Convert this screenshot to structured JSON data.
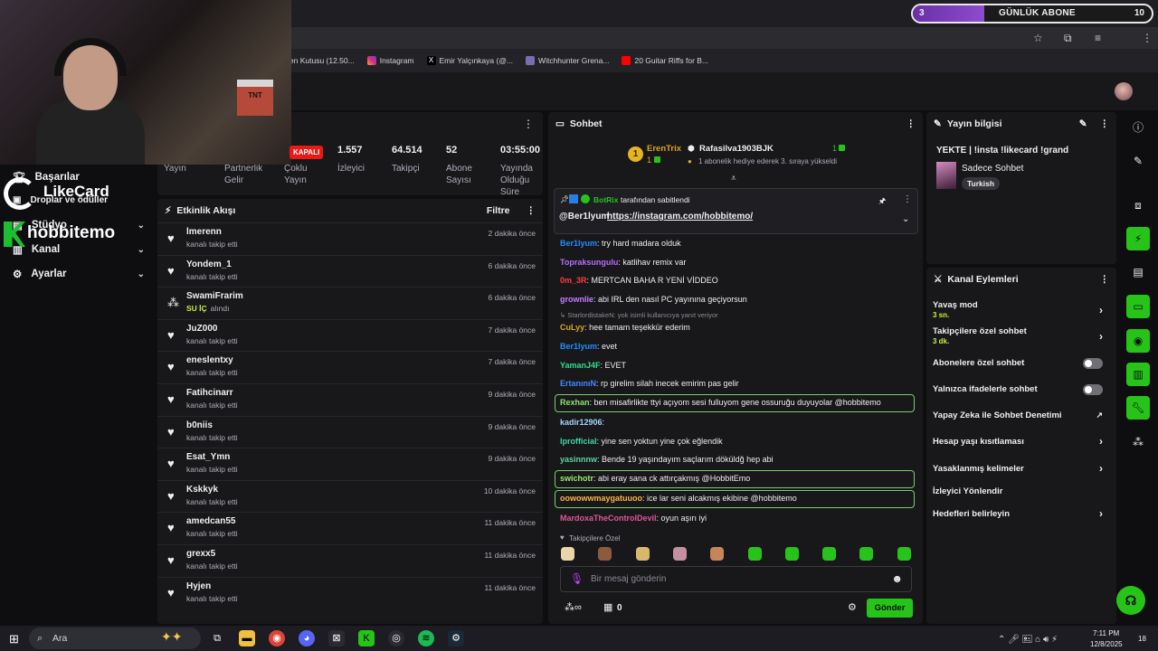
{
  "sub_goal": {
    "current": "3",
    "label": "GÜNLÜK ABONE",
    "target": "10",
    "progress": 0.3
  },
  "bookmarks": [
    {
      "label": "len Kutusu (12.50..."
    },
    {
      "label": "Instagram"
    },
    {
      "label": "Emir Yalçınkaya (@..."
    },
    {
      "label": "Witchhunter Grena..."
    },
    {
      "label": "20 Guitar Riffs for B..."
    }
  ],
  "overlays": {
    "likecard": "LikeCard",
    "hobbitemo": "hobbitemo",
    "tnt": "TNT"
  },
  "nav": {
    "achievements": "Başarılar",
    "drops": "Droplar ve ödüller",
    "studio": "Stüdyo",
    "channel": "Kanal",
    "settings": "Ayarlar"
  },
  "stats": {
    "offline": "KAPALI",
    "items": [
      {
        "value": "",
        "label": "Yayın"
      },
      {
        "value": "",
        "label": "Partnerlik Gelir"
      },
      {
        "value": "",
        "label": "Çoklu Yayın"
      },
      {
        "value": "1.557",
        "label": "İzleyici"
      },
      {
        "value": "64.514",
        "label": "Takipçi"
      },
      {
        "value": "52",
        "label": "Abone Sayısı"
      },
      {
        "value": "03:55:00",
        "label": "Yayında Olduğu Süre"
      }
    ]
  },
  "activity": {
    "title": "Etkinlik Akışı",
    "filter": "Filtre",
    "rows": [
      {
        "name": "lmerenn",
        "sub": "kanalı takip etti",
        "time": "2 dakika önce",
        "icon": "heart"
      },
      {
        "name": "Yondem_1",
        "sub": "kanalı takip etti",
        "time": "6 dakika önce",
        "icon": "heart"
      },
      {
        "name": "SwamiFrarim",
        "sub": "SU İÇ",
        "sub2": "alındı",
        "time": "6 dakika önce",
        "icon": "points"
      },
      {
        "name": "JuZ000",
        "sub": "kanalı takip etti",
        "time": "7 dakika önce",
        "icon": "heart"
      },
      {
        "name": "eneslentxy",
        "sub": "kanalı takip etti",
        "time": "7 dakika önce",
        "icon": "heart"
      },
      {
        "name": "Fatihcinarr",
        "sub": "kanalı takip etti",
        "time": "9 dakika önce",
        "icon": "heart"
      },
      {
        "name": "b0niis",
        "sub": "kanalı takip etti",
        "time": "9 dakika önce",
        "icon": "heart"
      },
      {
        "name": "Esat_Ymn",
        "sub": "kanalı takip etti",
        "time": "9 dakika önce",
        "icon": "heart"
      },
      {
        "name": "Kskkyk",
        "sub": "kanalı takip etti",
        "time": "10 dakika önce",
        "icon": "heart"
      },
      {
        "name": "amedcan55",
        "sub": "kanalı takip etti",
        "time": "11 dakika önce",
        "icon": "heart"
      },
      {
        "name": "grexx5",
        "sub": "kanalı takip etti",
        "time": "11 dakika önce",
        "icon": "heart"
      },
      {
        "name": "Hyjen",
        "sub": "kanalı takip etti",
        "time": "11 dakika önce",
        "icon": "heart"
      }
    ]
  },
  "chat": {
    "title": "Sohbet",
    "leader_name": "ErenTrix",
    "leader_count": "1",
    "gifter_name": "Rafasilva1903BJK",
    "gifter_count": "1",
    "gifter_note": "1 abonelik hediye ederek 3. sıraya yükseldi",
    "pinned_by": "BotRix",
    "pinned_note": "tarafından sabitlendi",
    "pinned_user": "@Ber1lyum",
    "pinned_link": "https://instagram.com/hobbitemo/",
    "messages": [
      {
        "user": "Ber1lyum",
        "text": ": try hard madara olduk",
        "color": "#1e90ff",
        "hl": false
      },
      {
        "user": "Topraksungulu",
        "text": ": katlihav remix var",
        "color": "#b56cff",
        "hl": false
      },
      {
        "user": "0m_3R",
        "text": ": MERTCAN BAHA R YENİ VİDDEO",
        "color": "#ff3b3b",
        "hl": false
      },
      {
        "user": "grownlie",
        "text": ": abi IRL den nasıl PC yayınına geçiyorsun",
        "color": "#c77dff",
        "hl": false
      },
      {
        "user": "",
        "text": "↳ StarlordistakeN: yok isimli kullanıcıya yanıt veriyor",
        "color": "#8a8a93",
        "hl": false,
        "reply": true
      },
      {
        "user": "CuLyy",
        "text": ": hee tamam teşekkür ederim",
        "color": "#daa520",
        "hl": false
      },
      {
        "user": "Ber1lyum",
        "text": ": evet",
        "color": "#1e90ff",
        "hl": false
      },
      {
        "user": "YamanJ4F",
        "text": ": EVET",
        "color": "#2ee08a",
        "hl": false
      },
      {
        "user": "ErtanınıN",
        "text": ": rp girelim silah inecek emirim pas gelir",
        "color": "#3d8bff",
        "hl": false
      },
      {
        "user": "Rexhan",
        "text": ": ben misafirlikte ttyi açıyom sesi fulluyom gene ossuruğu duyuyolar @hobbitemo",
        "color": "#8fe070",
        "hl": true
      },
      {
        "user": "kadir12906",
        "text": ":",
        "color": "#9fd7ff",
        "hl": false
      },
      {
        "user": "lprofficial",
        "text": ": yine sen yoktun yine çok eğlendik",
        "color": "#3ed9a0",
        "hl": false
      },
      {
        "user": "yasinnnw",
        "text": ": Bende 19 yaşındayım saçlarım döküldğ hep abi",
        "color": "#5fd1a0",
        "hl": false
      },
      {
        "user": "swichotr",
        "text": ": abi eray sana ck attırçakmış @HobbitEmo",
        "color": "#9bea6b",
        "hl": true
      },
      {
        "user": "oowowwmaygatuuoo",
        "text": ": ice lar seni alcakmış ekibine @hobbitemo",
        "color": "#ffb347",
        "hl": true
      },
      {
        "user": "MardoxaTheControlDevil",
        "text": ": oyun aşırı iyi",
        "color": "#e0559a",
        "hl": false
      }
    ],
    "followers_only": "Takipçilere Özel",
    "input_placeholder": "Bir mesaj gönderin",
    "points": "0",
    "send": "Gönder"
  },
  "info": {
    "title": "Yayın bilgisi",
    "stream_title": "YEKTE | !insta !likecard !grand",
    "category": "Sadece Sohbet",
    "tag": "Turkish"
  },
  "actions": {
    "title": "Kanal Eylemleri",
    "items": [
      {
        "label": "Yavaş mod",
        "sub": "3 sn.",
        "kind": "chevron"
      },
      {
        "label": "Takipçilere özel sohbet",
        "sub": "3 dk.",
        "kind": "chevron"
      },
      {
        "label": "Abonelere özel sohbet",
        "sub": "",
        "kind": "toggle"
      },
      {
        "label": "Yalnızca ifadelerle sohbet",
        "sub": "",
        "kind": "toggle"
      },
      {
        "label": "Yapay Zeka ile Sohbet Denetimi",
        "sub": "",
        "kind": "external"
      },
      {
        "label": "Hesap yaşı kısıtlaması",
        "sub": "",
        "kind": "chevron"
      },
      {
        "label": "Yasaklanmış kelimeler",
        "sub": "",
        "kind": "chevron"
      },
      {
        "label": "İzleyici Yönlendir",
        "sub": "",
        "kind": "none"
      },
      {
        "label": "Hedefleri belirleyin",
        "sub": "",
        "kind": "chevron"
      }
    ]
  },
  "taskbar": {
    "search": "Ara",
    "time": "7:11 PM",
    "date": "12/8/2025",
    "badge": "18"
  },
  "colors": {
    "accent": "#26c419",
    "purple": "#8e4ccc",
    "panel": "#18181b"
  }
}
